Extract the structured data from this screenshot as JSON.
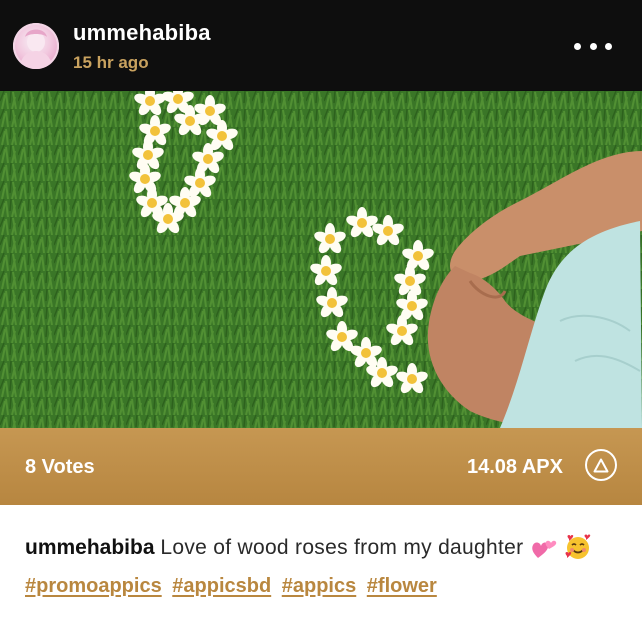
{
  "post": {
    "username": "ummehabiba",
    "timestamp": "15 hr ago",
    "more_icon": "more-horizontal-icon"
  },
  "media": {
    "description_icon": "photo"
  },
  "stats": {
    "votes": "8 Votes",
    "apx": "14.08 APX",
    "boost_icon": "triangle-in-circle-icon"
  },
  "caption": {
    "username": "ummehabiba",
    "text": "Love of wood roses from my daughter",
    "emojis": [
      "two-hearts-emoji",
      "smiling-face-with-hearts-emoji"
    ]
  },
  "hashtags": [
    "#promoappics",
    "#appicsbd",
    "#appics",
    "#flower"
  ],
  "colors": {
    "accent_gold": "#c69752",
    "timestamp_gold": "#c9a25f",
    "hashtag_gold": "#b9873f",
    "header_bg": "#0e0e0e"
  }
}
